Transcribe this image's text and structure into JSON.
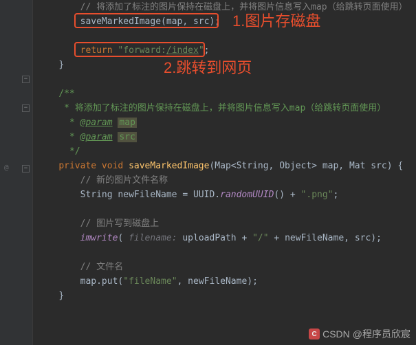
{
  "code": {
    "l1_comment": "// 将添加了标注的图片保持在磁盘上，并将图片信息写入map（给跳转页面使用）",
    "l2_call": "saveMarkedImage(map, src);",
    "l3_return_kw": "return ",
    "l3_return_str": "\"forward:",
    "l3_return_idx": "/index",
    "l3_return_end": "\"",
    "l3_semicolon": ";",
    "l4_brace": "}",
    "doc_open": "/**",
    "doc_line": " * 将添加了标注的图片保持在磁盘上，并将图片信息写入map（给跳转页面使用）",
    "doc_param": "@param",
    "doc_p1": "map",
    "doc_p2": "src",
    "doc_close": " */",
    "sig_mods": "private void ",
    "sig_name": "saveMarkedImage",
    "sig_params": "(Map<String, Object> map, Mat src) {",
    "c_newname": "// 新的图片文件名称",
    "l_newname_a": "String newFileName = UUID.",
    "l_newname_b": "randomUUID",
    "l_newname_c": "() + ",
    "l_newname_d": "\".png\"",
    "l_newname_e": ";",
    "c_write": "// 图片写到磁盘上",
    "l_write_fn": "imwrite",
    "l_write_open": "( ",
    "l_write_hint": "filename: ",
    "l_write_arg": "uploadPath + ",
    "l_write_slash": "\"/\"",
    "l_write_rest": " + newFileName, src);",
    "c_fname": "// 文件名",
    "l_put_a": "map.put(",
    "l_put_b": "\"fileName\"",
    "l_put_c": ", newFileName);",
    "l_close": "}"
  },
  "annotations": {
    "a1": "1.图片存磁盘",
    "a2": "2.跳转到网页"
  },
  "gutter": {
    "at": "@"
  },
  "watermark": {
    "site": "CSDN",
    "author": "@程序员欣宸"
  }
}
